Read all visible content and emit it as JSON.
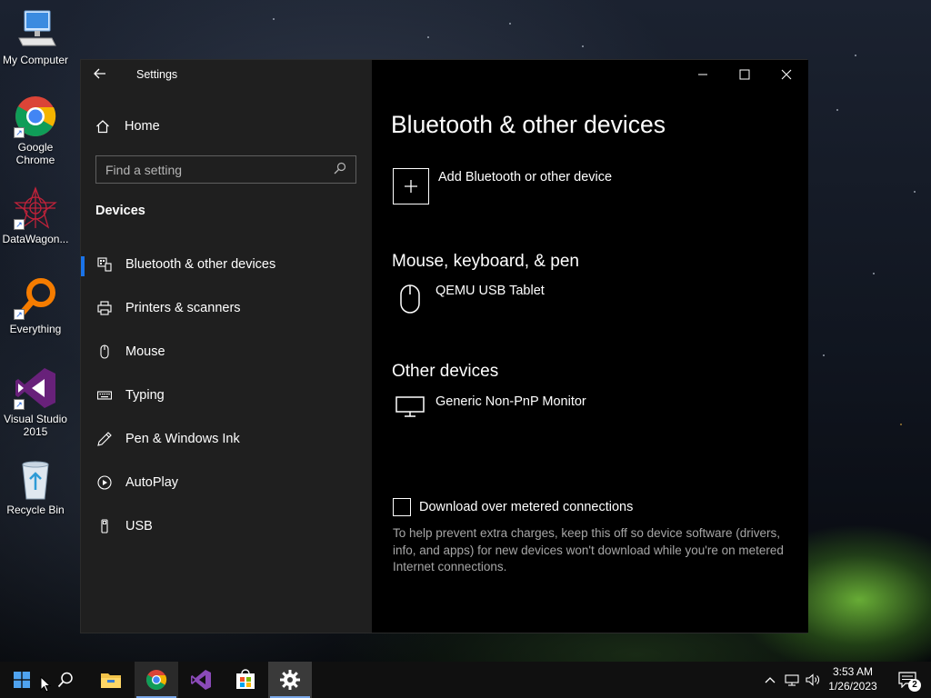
{
  "desktop": {
    "icons": [
      {
        "label": "My Computer"
      },
      {
        "label": "Google Chrome"
      },
      {
        "label": "DataWagon..."
      },
      {
        "label": "Everything"
      },
      {
        "label": "Visual Studio 2015"
      },
      {
        "label": "Recycle Bin"
      }
    ]
  },
  "settings": {
    "app_title": "Settings",
    "home_label": "Home",
    "search_placeholder": "Find a setting",
    "section_title": "Devices",
    "nav": [
      {
        "label": "Bluetooth & other devices",
        "icon": "bluetooth-devices-icon",
        "selected": true
      },
      {
        "label": "Printers & scanners",
        "icon": "printer-icon"
      },
      {
        "label": "Mouse",
        "icon": "mouse-icon"
      },
      {
        "label": "Typing",
        "icon": "keyboard-icon"
      },
      {
        "label": "Pen & Windows Ink",
        "icon": "pen-icon"
      },
      {
        "label": "AutoPlay",
        "icon": "autoplay-icon"
      },
      {
        "label": "USB",
        "icon": "usb-icon"
      }
    ],
    "page_title": "Bluetooth & other devices",
    "add_device_label": "Add Bluetooth or other device",
    "mouse_section": {
      "title": "Mouse, keyboard, & pen",
      "devices": [
        {
          "name": "QEMU USB Tablet",
          "icon": "mouse-icon"
        }
      ]
    },
    "other_section": {
      "title": "Other devices",
      "devices": [
        {
          "name": "Generic Non-PnP Monitor",
          "icon": "monitor-icon"
        }
      ]
    },
    "metered": {
      "label": "Download over metered connections",
      "checked": false,
      "help": "To help prevent extra charges, keep this off so device software (drivers, info, and apps) for new devices won't download while you're on metered Internet connections."
    }
  },
  "taskbar": {
    "time": "3:53 AM",
    "date": "1/26/2023",
    "notification_count": "2",
    "accent_color": "#1a73e8"
  }
}
